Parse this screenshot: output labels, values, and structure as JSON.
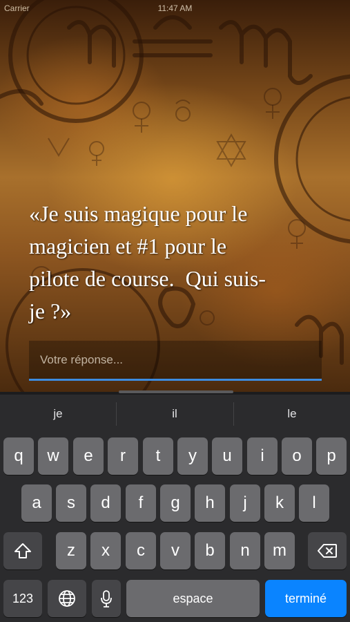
{
  "status_bar": {
    "carrier": "Carrier",
    "time": "11:47 AM"
  },
  "riddle": {
    "text": "«Je suis magique pour le\nmagicien et #1 pour le\npilote de course.  Qui suis-\nje ?»"
  },
  "answer": {
    "placeholder": "Votre réponse...",
    "value": "",
    "accent_color": "#3d8ce0"
  },
  "keyboard": {
    "suggestions": [
      "je",
      "il",
      "le"
    ],
    "row1": [
      "q",
      "w",
      "e",
      "r",
      "t",
      "y",
      "u",
      "i",
      "o",
      "p"
    ],
    "row2": [
      "a",
      "s",
      "d",
      "f",
      "g",
      "h",
      "j",
      "k",
      "l"
    ],
    "row3": [
      "z",
      "x",
      "c",
      "v",
      "b",
      "n",
      "m"
    ],
    "shift_icon": "shift-arrow-icon",
    "delete_icon": "backspace-icon",
    "numbers_label": "123",
    "globe_icon": "globe-icon",
    "mic_icon": "microphone-icon",
    "space_label": "espace",
    "done_label": "terminé",
    "done_color": "#0a84ff"
  }
}
